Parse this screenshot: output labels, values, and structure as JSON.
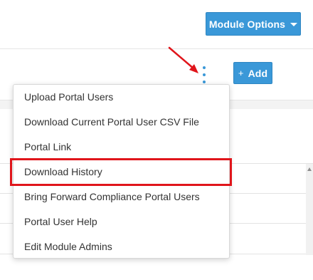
{
  "header": {
    "module_options_label": "Module Options",
    "module_options_caret_icon": "caret-down-icon"
  },
  "toolbar": {
    "more_actions_icon": "kebab-vertical-icon",
    "add_label": "Add",
    "add_icon_glyph": "+"
  },
  "dropdown": {
    "items": [
      {
        "label": "Upload Portal Users"
      },
      {
        "label": "Download Current Portal User CSV File"
      },
      {
        "label": "Portal Link"
      },
      {
        "label": "Download History"
      },
      {
        "label": "Bring Forward Compliance Portal Users"
      },
      {
        "label": "Portal User Help"
      },
      {
        "label": "Edit Module Admins"
      }
    ],
    "highlighted_item": "Download History"
  },
  "colors": {
    "primary": "#3a98d8",
    "annotation_red": "#e0151b",
    "menu_text": "#333333"
  }
}
